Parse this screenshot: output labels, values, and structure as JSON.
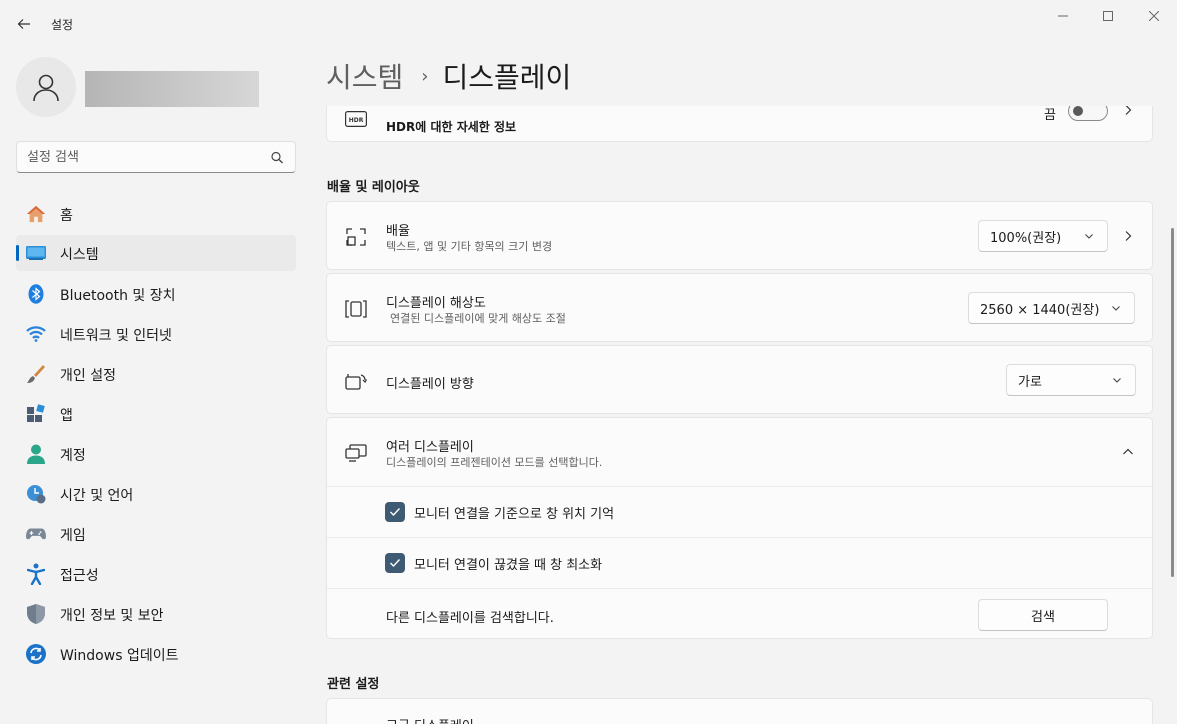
{
  "app": {
    "title": "설정"
  },
  "colors": {
    "accent": "#0067c0",
    "checkbox": "#3f5a73",
    "background": "#f3f3f3",
    "card": "#fbfbfb"
  },
  "search": {
    "placeholder": "설정 검색"
  },
  "sidebar": {
    "items": [
      {
        "label": "홈",
        "icon": "home-icon"
      },
      {
        "label": "시스템",
        "icon": "system-monitor-icon",
        "active": true
      },
      {
        "label": "Bluetooth 및 장치",
        "icon": "bluetooth-icon"
      },
      {
        "label": "네트워크 및 인터넷",
        "icon": "wifi-icon"
      },
      {
        "label": "개인 설정",
        "icon": "paintbrush-icon"
      },
      {
        "label": "앱",
        "icon": "apps-icon"
      },
      {
        "label": "계정",
        "icon": "account-icon"
      },
      {
        "label": "시간 및 언어",
        "icon": "time-language-icon"
      },
      {
        "label": "게임",
        "icon": "gamepad-icon"
      },
      {
        "label": "접근성",
        "icon": "accessibility-icon"
      },
      {
        "label": "개인 정보 및 보안",
        "icon": "shield-icon"
      },
      {
        "label": "Windows 업데이트",
        "icon": "windows-update-icon"
      }
    ]
  },
  "breadcrumb": {
    "parent": "시스템",
    "separator": "›",
    "current": "디스플레이"
  },
  "hdr": {
    "subtitle": "HDR에 대한 자세한 정보",
    "toggle_label": "끔",
    "toggle_on": false
  },
  "section_scale": {
    "title": "배율 및 레이아웃"
  },
  "scale": {
    "title": "배율",
    "subtitle": "텍스트, 앱 및 기타 항목의 크기 변경",
    "value": "100%(권장)"
  },
  "resolution": {
    "title": "디스플레이 해상도",
    "subtitle": "연결된 디스플레이에 맞게 해상도 조절",
    "value": "2560 × 1440(권장)"
  },
  "orientation": {
    "title": "디스플레이 방향",
    "value": "가로"
  },
  "multi": {
    "title": "여러 디스플레이",
    "subtitle": "디스플레이의 프레젠테이션 모드를 선택합니다.",
    "expanded": true,
    "option1": {
      "label": "모니터 연결을 기준으로 창 위치 기억",
      "checked": true
    },
    "option2": {
      "label": "모니터 연결이 끊겼을 때 창 최소화",
      "checked": true
    },
    "detect": {
      "label": "다른 디스플레이를 검색합니다.",
      "button": "검색"
    }
  },
  "section_related": {
    "title": "관련 설정"
  },
  "related": {
    "first_item": "고급 디스플레이"
  }
}
